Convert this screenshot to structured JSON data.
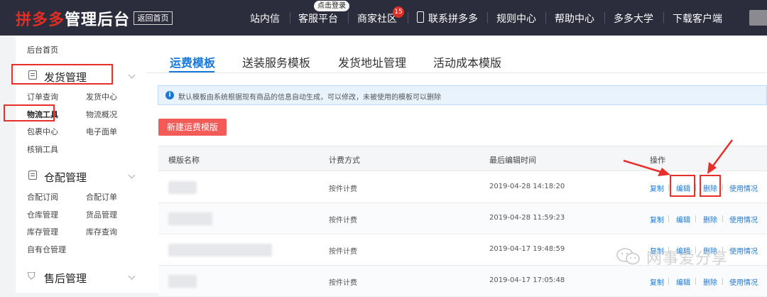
{
  "topbar": {
    "logo_brand": "拼多多",
    "logo_rest": "管理后台",
    "back_home": "返回首页",
    "login_badge": "点击登录",
    "community_badge": "15",
    "nav": [
      "站内信",
      "客服平台",
      "商家社区",
      "联系拼多多",
      "规则中心",
      "帮助中心",
      "多多大学",
      "下载客户端"
    ]
  },
  "sidebar": {
    "home": "后台首页",
    "sections": [
      {
        "title": "发货管理",
        "links": [
          "订单查询",
          "发货中心",
          "物流工具",
          "物流概况",
          "包裹中心",
          "电子面单",
          "核销工具"
        ]
      },
      {
        "title": "仓配管理",
        "links": [
          "合配订阅",
          "合配订单",
          "仓库管理",
          "货品管理",
          "库存管理",
          "库存查询",
          "自有仓管理"
        ]
      },
      {
        "title": "售后管理",
        "links": []
      }
    ]
  },
  "main": {
    "tabs": [
      "运费模板",
      "送装服务模板",
      "发货地址管理",
      "活动成本模版"
    ],
    "active_tab": "运费模板",
    "notice": "默认模板由系统根据现有商品的信息自动生成，可以修改，未被使用的模板可以删除",
    "new_button": "新建运费模版",
    "table": {
      "headers": [
        "模版名称",
        "计费方式",
        "最后编辑时间",
        "操作"
      ],
      "rows": [
        {
          "billing": "按件计费",
          "edited": "2019-04-28 14:18:20"
        },
        {
          "billing": "按件计费",
          "edited": "2019-04-28 11:59:23"
        },
        {
          "billing": "按件计费",
          "edited": "2019-04-17 19:48:59"
        },
        {
          "billing": "按件计费",
          "edited": "2019-04-17 17:05:48"
        }
      ],
      "actions": [
        "复制",
        "编辑",
        "删除",
        "使用情况"
      ]
    }
  },
  "watermark": "网事爱分享",
  "colors": {
    "topbar_bg": "#2b2c3c",
    "brand_red": "#e02e24",
    "link_blue": "#1979d8",
    "button_red": "#f25b58",
    "annotation_red": "#e8302a"
  }
}
